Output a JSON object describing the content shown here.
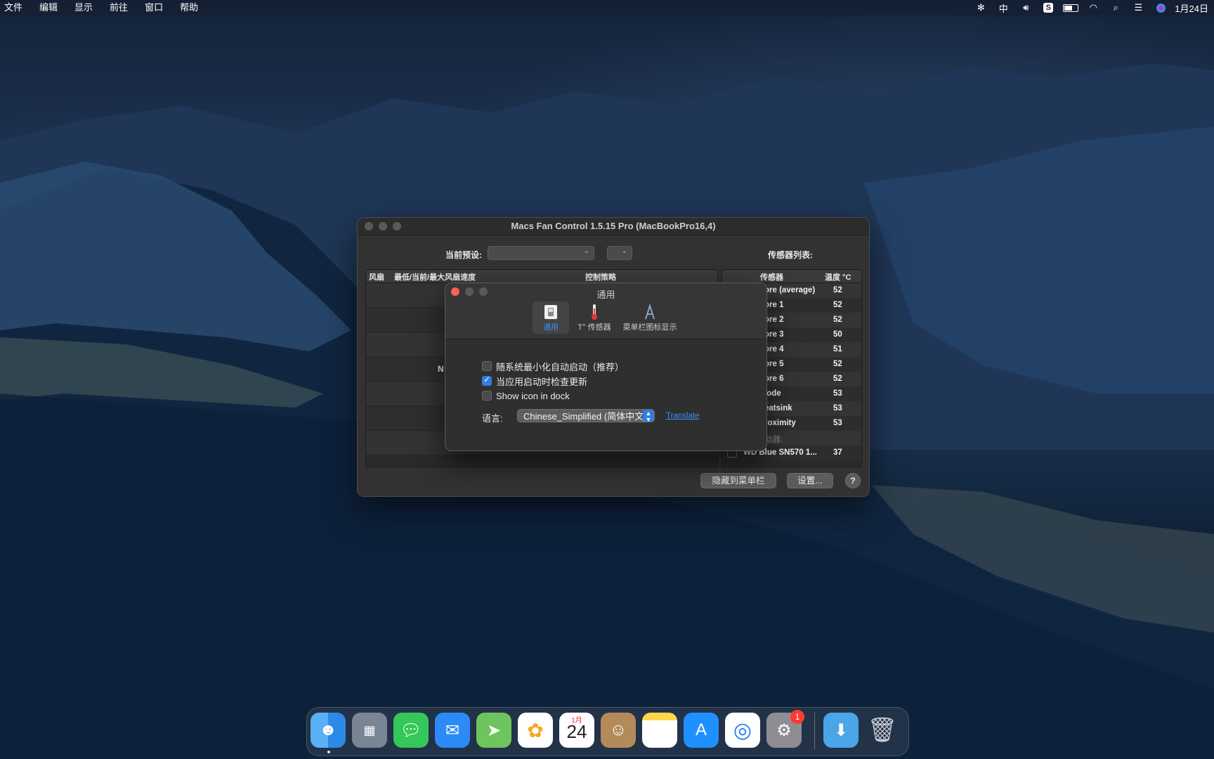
{
  "menubar": {
    "items": [
      "文件",
      "编辑",
      "显示",
      "前往",
      "窗口",
      "帮助"
    ],
    "input_method": "中",
    "clock": "1月24日"
  },
  "main_window": {
    "title": "Macs Fan Control 1.5.15 Pro (MacBookPro16,4)",
    "preset_label": "当前预设:",
    "sensors_label": "传感器列表:",
    "fan_table": {
      "headers": [
        "风扇",
        "最低/当前/最大风扇速度",
        "控制策略"
      ],
      "partial_text": "N"
    },
    "sensor_table": {
      "headers": [
        "传感器",
        "温度 °C"
      ],
      "rows": [
        {
          "name": "ore (average)",
          "value": "52"
        },
        {
          "name": "ore 1",
          "value": "52"
        },
        {
          "name": "ore 2",
          "value": "52"
        },
        {
          "name": "ore 3",
          "value": "50"
        },
        {
          "name": "ore 4",
          "value": "51"
        },
        {
          "name": "ore 5",
          "value": "52"
        },
        {
          "name": "ore 6",
          "value": "52"
        },
        {
          "name": "iode",
          "value": "53"
        },
        {
          "name": "eatsink",
          "value": "53"
        },
        {
          "name": "roximity",
          "value": "53"
        },
        {
          "name": "动器:",
          "value": ""
        },
        {
          "name": "WD Blue SN570 1...",
          "value": "37"
        }
      ]
    },
    "buttons": {
      "hide_to_menubar": "隐藏到菜单栏",
      "settings": "设置...",
      "help": "?"
    }
  },
  "prefs_dialog": {
    "title": "通用",
    "tabs": [
      {
        "label": "通用",
        "icon": "general-switch-icon",
        "active": true
      },
      {
        "label": "T° 传感器",
        "icon": "thermometer-icon",
        "active": false
      },
      {
        "label": "菜单栏图标显示",
        "icon": "font-a-icon",
        "active": false
      }
    ],
    "options": [
      {
        "label": "随系统最小化自动启动（推荐）",
        "checked": false
      },
      {
        "label": "当应用启动时检查更新",
        "checked": true
      },
      {
        "label": "Show icon in dock",
        "checked": false
      }
    ],
    "language_label": "语言:",
    "language_value": "Chinese_Simplified (简体中文)",
    "translate_link": "Translate"
  },
  "dock": {
    "apps": [
      {
        "name": "Finder",
        "icon": "finder-icon"
      },
      {
        "name": "Launchpad",
        "icon": "launchpad-icon"
      },
      {
        "name": "Messages",
        "icon": "messages-icon"
      },
      {
        "name": "Mail",
        "icon": "mail-icon"
      },
      {
        "name": "Maps",
        "icon": "maps-icon"
      },
      {
        "name": "Photos",
        "icon": "photos-icon"
      },
      {
        "name": "Calendar",
        "icon": "calendar-icon"
      },
      {
        "name": "Contacts",
        "icon": "contacts-icon"
      },
      {
        "name": "Notes",
        "icon": "notes-icon"
      },
      {
        "name": "App Store",
        "icon": "app-store-icon"
      },
      {
        "name": "Safari",
        "icon": "safari-icon"
      },
      {
        "name": "System Preferences",
        "icon": "system-preferences-icon"
      },
      {
        "name": "Downloads",
        "icon": "downloads-folder-icon"
      },
      {
        "name": "Trash",
        "icon": "trash-icon"
      }
    ],
    "calendar_month": "1月",
    "calendar_day": "24",
    "system_prefs_badge": "1"
  }
}
